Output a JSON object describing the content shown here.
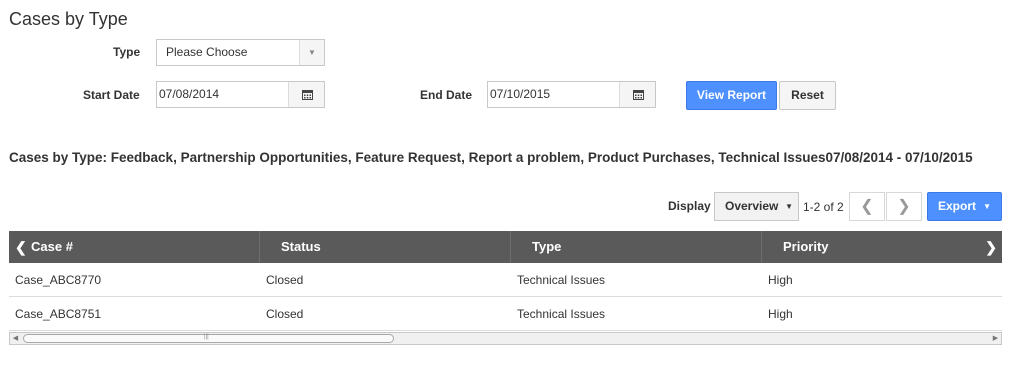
{
  "page": {
    "title": "Cases by Type"
  },
  "filters": {
    "type_label": "Type",
    "type_value": "Please Choose",
    "start_label": "Start Date",
    "start_value": "07/08/2014",
    "end_label": "End Date",
    "end_value": "07/10/2015",
    "view_report_label": "View Report",
    "reset_label": "Reset"
  },
  "report": {
    "heading": "Cases by Type: Feedback, Partnership Opportunities, Feature Request, Report a problem, Product Purchases, Technical Issues07/08/2014 - 07/10/2015"
  },
  "toolbar": {
    "display_label": "Display",
    "display_value": "Overview",
    "page_count": "1-2 of 2",
    "export_label": "Export"
  },
  "table": {
    "columns": [
      "Case #",
      "Status",
      "Type",
      "Priority"
    ],
    "rows": [
      [
        "Case_ABC8770",
        "Closed",
        "Technical Issues",
        "High"
      ],
      [
        "Case_ABC8751",
        "Closed",
        "Technical Issues",
        "High"
      ]
    ]
  },
  "icons": {
    "calendar": "calendar-icon",
    "dropdown": "chevron-down-icon",
    "prev": "chevron-left-icon",
    "next": "chevron-right-icon"
  },
  "colors": {
    "primary": "#4d90fe",
    "header_bg": "#5a5a5a"
  }
}
